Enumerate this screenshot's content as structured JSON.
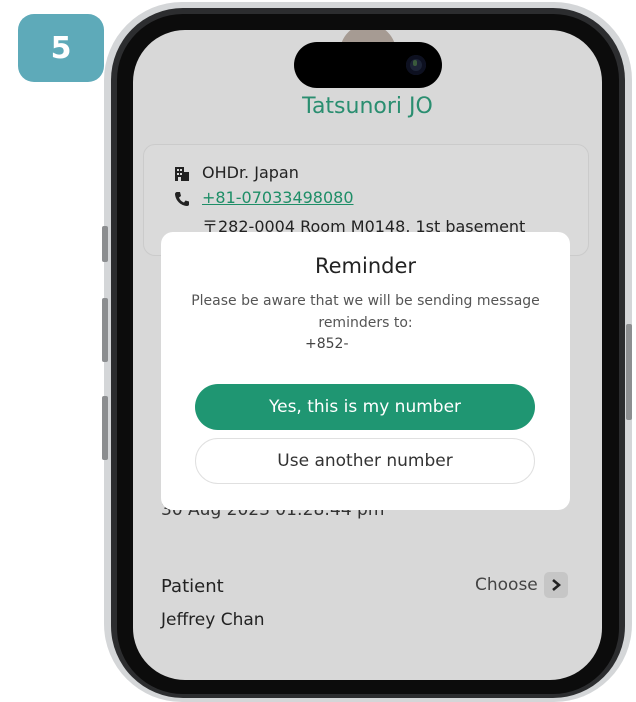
{
  "step": {
    "number": "5",
    "color": "#5eaab9"
  },
  "doctor": {
    "name": "Tatsunori JO"
  },
  "clinic": {
    "name": "OHDr. Japan",
    "name_icon": "building-icon",
    "phone": "+81-07033498080",
    "phone_icon": "phone-icon",
    "address": "〒282-0004 Room M0148, 1st basement"
  },
  "appointment": {
    "datetime": "30 Aug 2023 01:28:44 pm"
  },
  "patient": {
    "label": "Patient",
    "choose_label": "Choose",
    "choose_icon": "chevron-right-icon",
    "name": "Jeffrey Chan"
  },
  "modal": {
    "title": "Reminder",
    "message": "Please be aware that we will be sending message reminders to:",
    "number": "+852-",
    "confirm_label": "Yes, this is my number",
    "other_label": "Use another number"
  },
  "colors": {
    "accent": "#1f9672",
    "link": "#1e8e67"
  }
}
